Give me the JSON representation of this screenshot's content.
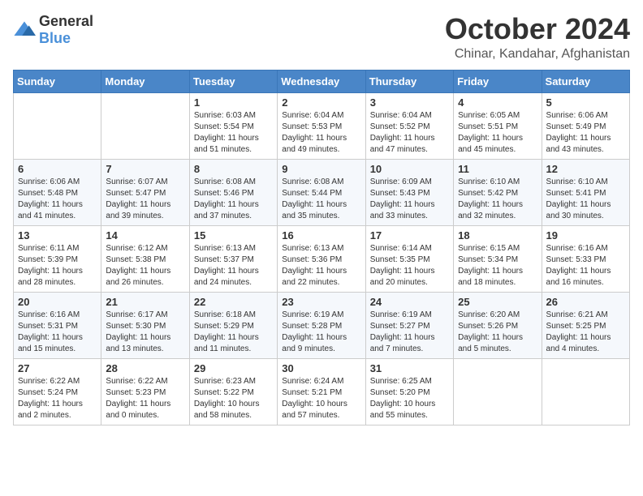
{
  "logo": {
    "general": "General",
    "blue": "Blue"
  },
  "title": {
    "month": "October 2024",
    "location": "Chinar, Kandahar, Afghanistan"
  },
  "weekdays": [
    "Sunday",
    "Monday",
    "Tuesday",
    "Wednesday",
    "Thursday",
    "Friday",
    "Saturday"
  ],
  "weeks": [
    [
      {
        "day": "",
        "info": ""
      },
      {
        "day": "",
        "info": ""
      },
      {
        "day": "1",
        "info": "Sunrise: 6:03 AM\nSunset: 5:54 PM\nDaylight: 11 hours and 51 minutes."
      },
      {
        "day": "2",
        "info": "Sunrise: 6:04 AM\nSunset: 5:53 PM\nDaylight: 11 hours and 49 minutes."
      },
      {
        "day": "3",
        "info": "Sunrise: 6:04 AM\nSunset: 5:52 PM\nDaylight: 11 hours and 47 minutes."
      },
      {
        "day": "4",
        "info": "Sunrise: 6:05 AM\nSunset: 5:51 PM\nDaylight: 11 hours and 45 minutes."
      },
      {
        "day": "5",
        "info": "Sunrise: 6:06 AM\nSunset: 5:49 PM\nDaylight: 11 hours and 43 minutes."
      }
    ],
    [
      {
        "day": "6",
        "info": "Sunrise: 6:06 AM\nSunset: 5:48 PM\nDaylight: 11 hours and 41 minutes."
      },
      {
        "day": "7",
        "info": "Sunrise: 6:07 AM\nSunset: 5:47 PM\nDaylight: 11 hours and 39 minutes."
      },
      {
        "day": "8",
        "info": "Sunrise: 6:08 AM\nSunset: 5:46 PM\nDaylight: 11 hours and 37 minutes."
      },
      {
        "day": "9",
        "info": "Sunrise: 6:08 AM\nSunset: 5:44 PM\nDaylight: 11 hours and 35 minutes."
      },
      {
        "day": "10",
        "info": "Sunrise: 6:09 AM\nSunset: 5:43 PM\nDaylight: 11 hours and 33 minutes."
      },
      {
        "day": "11",
        "info": "Sunrise: 6:10 AM\nSunset: 5:42 PM\nDaylight: 11 hours and 32 minutes."
      },
      {
        "day": "12",
        "info": "Sunrise: 6:10 AM\nSunset: 5:41 PM\nDaylight: 11 hours and 30 minutes."
      }
    ],
    [
      {
        "day": "13",
        "info": "Sunrise: 6:11 AM\nSunset: 5:39 PM\nDaylight: 11 hours and 28 minutes."
      },
      {
        "day": "14",
        "info": "Sunrise: 6:12 AM\nSunset: 5:38 PM\nDaylight: 11 hours and 26 minutes."
      },
      {
        "day": "15",
        "info": "Sunrise: 6:13 AM\nSunset: 5:37 PM\nDaylight: 11 hours and 24 minutes."
      },
      {
        "day": "16",
        "info": "Sunrise: 6:13 AM\nSunset: 5:36 PM\nDaylight: 11 hours and 22 minutes."
      },
      {
        "day": "17",
        "info": "Sunrise: 6:14 AM\nSunset: 5:35 PM\nDaylight: 11 hours and 20 minutes."
      },
      {
        "day": "18",
        "info": "Sunrise: 6:15 AM\nSunset: 5:34 PM\nDaylight: 11 hours and 18 minutes."
      },
      {
        "day": "19",
        "info": "Sunrise: 6:16 AM\nSunset: 5:33 PM\nDaylight: 11 hours and 16 minutes."
      }
    ],
    [
      {
        "day": "20",
        "info": "Sunrise: 6:16 AM\nSunset: 5:31 PM\nDaylight: 11 hours and 15 minutes."
      },
      {
        "day": "21",
        "info": "Sunrise: 6:17 AM\nSunset: 5:30 PM\nDaylight: 11 hours and 13 minutes."
      },
      {
        "day": "22",
        "info": "Sunrise: 6:18 AM\nSunset: 5:29 PM\nDaylight: 11 hours and 11 minutes."
      },
      {
        "day": "23",
        "info": "Sunrise: 6:19 AM\nSunset: 5:28 PM\nDaylight: 11 hours and 9 minutes."
      },
      {
        "day": "24",
        "info": "Sunrise: 6:19 AM\nSunset: 5:27 PM\nDaylight: 11 hours and 7 minutes."
      },
      {
        "day": "25",
        "info": "Sunrise: 6:20 AM\nSunset: 5:26 PM\nDaylight: 11 hours and 5 minutes."
      },
      {
        "day": "26",
        "info": "Sunrise: 6:21 AM\nSunset: 5:25 PM\nDaylight: 11 hours and 4 minutes."
      }
    ],
    [
      {
        "day": "27",
        "info": "Sunrise: 6:22 AM\nSunset: 5:24 PM\nDaylight: 11 hours and 2 minutes."
      },
      {
        "day": "28",
        "info": "Sunrise: 6:22 AM\nSunset: 5:23 PM\nDaylight: 11 hours and 0 minutes."
      },
      {
        "day": "29",
        "info": "Sunrise: 6:23 AM\nSunset: 5:22 PM\nDaylight: 10 hours and 58 minutes."
      },
      {
        "day": "30",
        "info": "Sunrise: 6:24 AM\nSunset: 5:21 PM\nDaylight: 10 hours and 57 minutes."
      },
      {
        "day": "31",
        "info": "Sunrise: 6:25 AM\nSunset: 5:20 PM\nDaylight: 10 hours and 55 minutes."
      },
      {
        "day": "",
        "info": ""
      },
      {
        "day": "",
        "info": ""
      }
    ]
  ]
}
